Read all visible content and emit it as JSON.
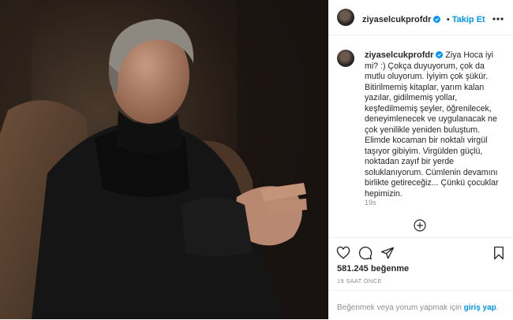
{
  "post": {
    "username": "ziyaselcukprofdr",
    "follow_label": "Takip Et",
    "caption": "Ziya Hoca iyi mi? :) Çokça duyuyorum, çok da mutlu oluyorum. İyiyim çok şükür. Bitirilmemiş kitaplar, yarım kalan yazılar, gidilmemiş yollar, keşfedilmemiş şeyler, öğrenilecek, deneyimlenecek ve uygulanacak ne çok yenilikle yeniden buluştum. Elimde kocaman bir noktalı virgül taşıyor gibiyim. Virgülden güçlü, noktadan zayıf bir yerde soluklanıyorum. Cümlenin devamını birlikte getireceğiz... Çünkü çocuklar hepimizin.",
    "caption_age": "19s",
    "likes": "581.245 beğenme",
    "posted_ago": "19 SAAT ÖNCE",
    "comment_prompt": "Beğenmek veya yorum yapmak için",
    "login_link": "giriş yap",
    "comment_prompt_end": "."
  },
  "icons": {
    "more": "more-options-icon",
    "verified": "verified-badge-icon",
    "like": "heart-icon",
    "comment": "comment-icon",
    "share": "share-icon",
    "save": "bookmark-icon",
    "load_more": "plus-circle-icon"
  },
  "colors": {
    "link": "#0095f6",
    "text": "#262626",
    "muted": "#8e8e8e",
    "border": "#efefef"
  }
}
